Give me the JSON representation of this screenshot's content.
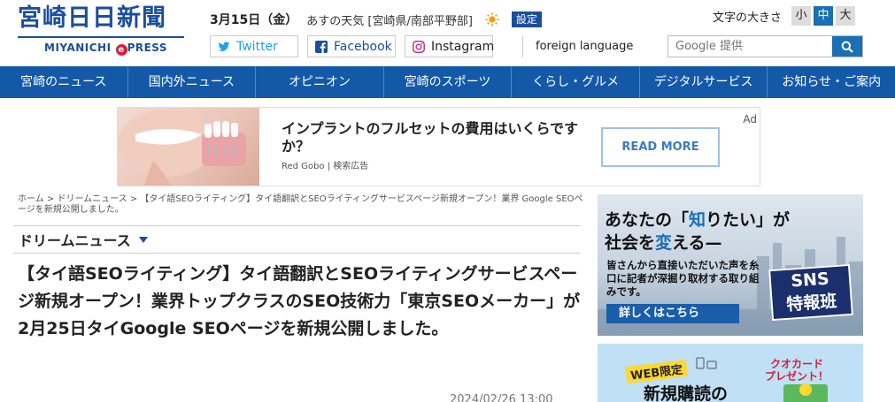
{
  "header": {
    "logo_text": "宮崎日日新聞",
    "logo_sub": "MIYANICHI",
    "logo_sub_mark": "e",
    "logo_sub_suffix": "PRESS",
    "date": "3月15日（金）",
    "weather_text": "あすの天気 [宮崎県/南部平野部]",
    "weather_icon": "sun-icon",
    "settings_label": "設定",
    "font_size_label": "文字の大きさ",
    "font_sizes": [
      "小",
      "中",
      "大"
    ],
    "font_size_selected": "中",
    "social": {
      "twitter": "Twitter",
      "facebook": "Facebook",
      "instagram": "Instagram"
    },
    "foreign_language": "foreign language",
    "search_placeholder": "Google 提供"
  },
  "nav": {
    "items": [
      "宮崎のニュース",
      "国内外ニュース",
      "オピニオン",
      "宮崎のスポーツ",
      "くらし・グルメ",
      "デジタルサービス",
      "お知らせ・ご案内"
    ]
  },
  "ad": {
    "title": "インプラントのフルセットの費用はいくらですか？",
    "source": "Red Gobo | 検索広告",
    "button": "READ MORE",
    "tag": "Ad"
  },
  "article": {
    "breadcrumb": [
      "ホーム",
      "ドリームニュース",
      "【タイ語SEOライティング】タイ語翻訳とSEOライティングサービスページ新規オープン！業界トップクラスのSEO技術力「東京SEOメーカー」が2月25日タイGoogle SEOページを新規公開しました。"
    ],
    "breadcrumb_visible": "【タイ語SEOライティング】タイ語翻訳とSEOライティングサービスページ新規オープン！業界 Google SEOページを新規公開しました。",
    "category": "ドリームニュース",
    "headline": "【タイ語SEOライティング】タイ語翻訳とSEOライティングサービスページ新規オープン！業界トップクラスのSEO技術力「東京SEOメーカー」が2月25日タイGoogle SEOページを新規公開しました。",
    "timestamp": "2024/02/26 13:00"
  },
  "sidebar": {
    "banner1": {
      "line1_pre": "あなたの「",
      "line1_hl": "知",
      "line1_post": "りたい」が",
      "line2_pre": "社会を",
      "line2_hl": "変",
      "line2_post": "える—",
      "desc": "皆さんから直接いただいた声を糸口に記者が深掘り取材する取り組みです。",
      "more": "詳しくはこちら",
      "badge_line1": "SNS",
      "badge_line2": "特報班"
    },
    "banner2": {
      "web_label": "WEB限定",
      "title": "新規購読の",
      "card_line1": "クオカード",
      "card_line2": "プレゼント！"
    }
  },
  "colors": {
    "brand": "#1a4e9e",
    "nav_bg": "#1459a8",
    "accent": "#1a6fb5",
    "twitter": "#1da1f2"
  }
}
